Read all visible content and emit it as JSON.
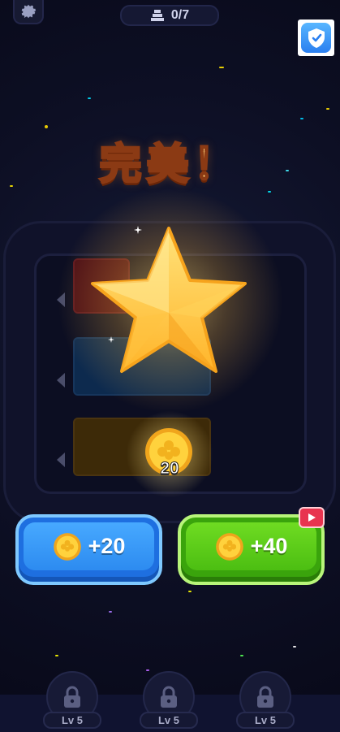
{
  "header": {
    "counter_text": "0/7",
    "settings_icon": "gear-icon",
    "stack_icon": "stack-icon",
    "shield_icon": "shield-icon"
  },
  "result": {
    "title": "完美！",
    "rating_icon": "star-icon",
    "coin_reward": "20"
  },
  "buttons": {
    "claim_label": "+20",
    "ad_claim_label": "+40",
    "coin_icon": "coin-icon",
    "video_icon": "video-play-icon"
  },
  "levels": [
    {
      "label": "Lv 5"
    },
    {
      "label": "Lv 5"
    },
    {
      "label": "Lv 5"
    }
  ],
  "colors": {
    "background": "#0d0f24",
    "title_fill": "#ffcf7a",
    "blue_button": "#2d8bf0",
    "green_button": "#4cbe12",
    "video_badge": "#e8344f"
  }
}
